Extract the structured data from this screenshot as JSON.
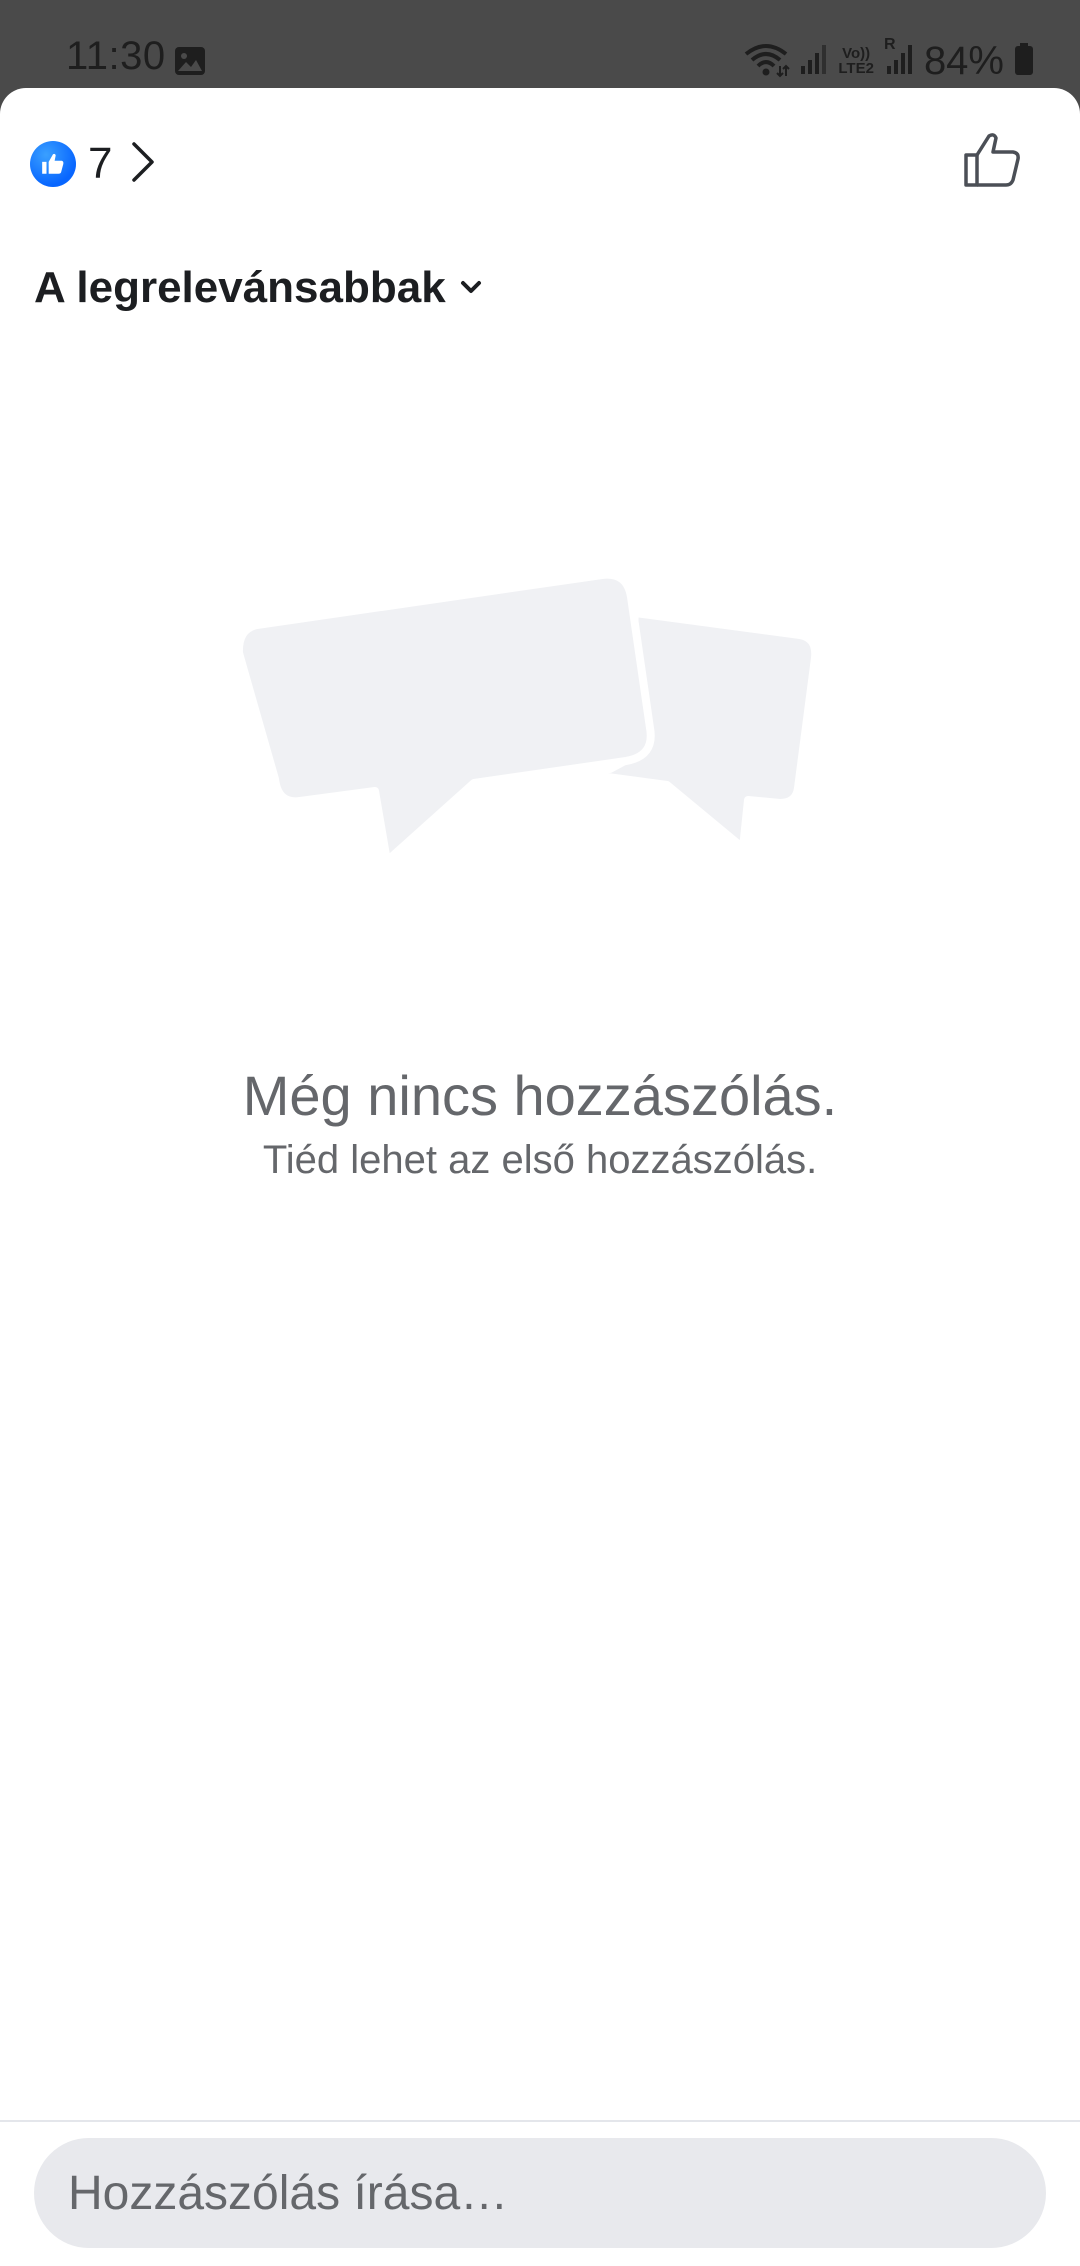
{
  "status_bar": {
    "time": "11:30",
    "battery": "84%",
    "icons": [
      "gallery-icon",
      "wifi-icon",
      "signal-icon",
      "volte-lte2-icon",
      "roaming-signal-icon",
      "battery-icon"
    ],
    "network_label_top": "Vo))",
    "network_label_bottom": "LTE2",
    "roaming_label": "R"
  },
  "header": {
    "reaction_icon": "like-reaction-icon",
    "reaction_count": "7",
    "like_button_icon": "thumbs-up-outline-icon"
  },
  "sort": {
    "label": "A legrelevánsabbak",
    "icon": "chevron-down-icon"
  },
  "empty_state": {
    "icon": "speech-bubbles-icon",
    "title": "Még nincs hozzászólás.",
    "subtitle": "Tiéd lehet az első hozzászólás."
  },
  "composer": {
    "placeholder": "Hozzászólás írása…",
    "value": ""
  },
  "colors": {
    "accent": "#0866ff",
    "text_primary": "#1c1e21",
    "text_secondary": "#65676b",
    "input_background": "#e8e9ed",
    "illustration": "#f0f1f4"
  }
}
